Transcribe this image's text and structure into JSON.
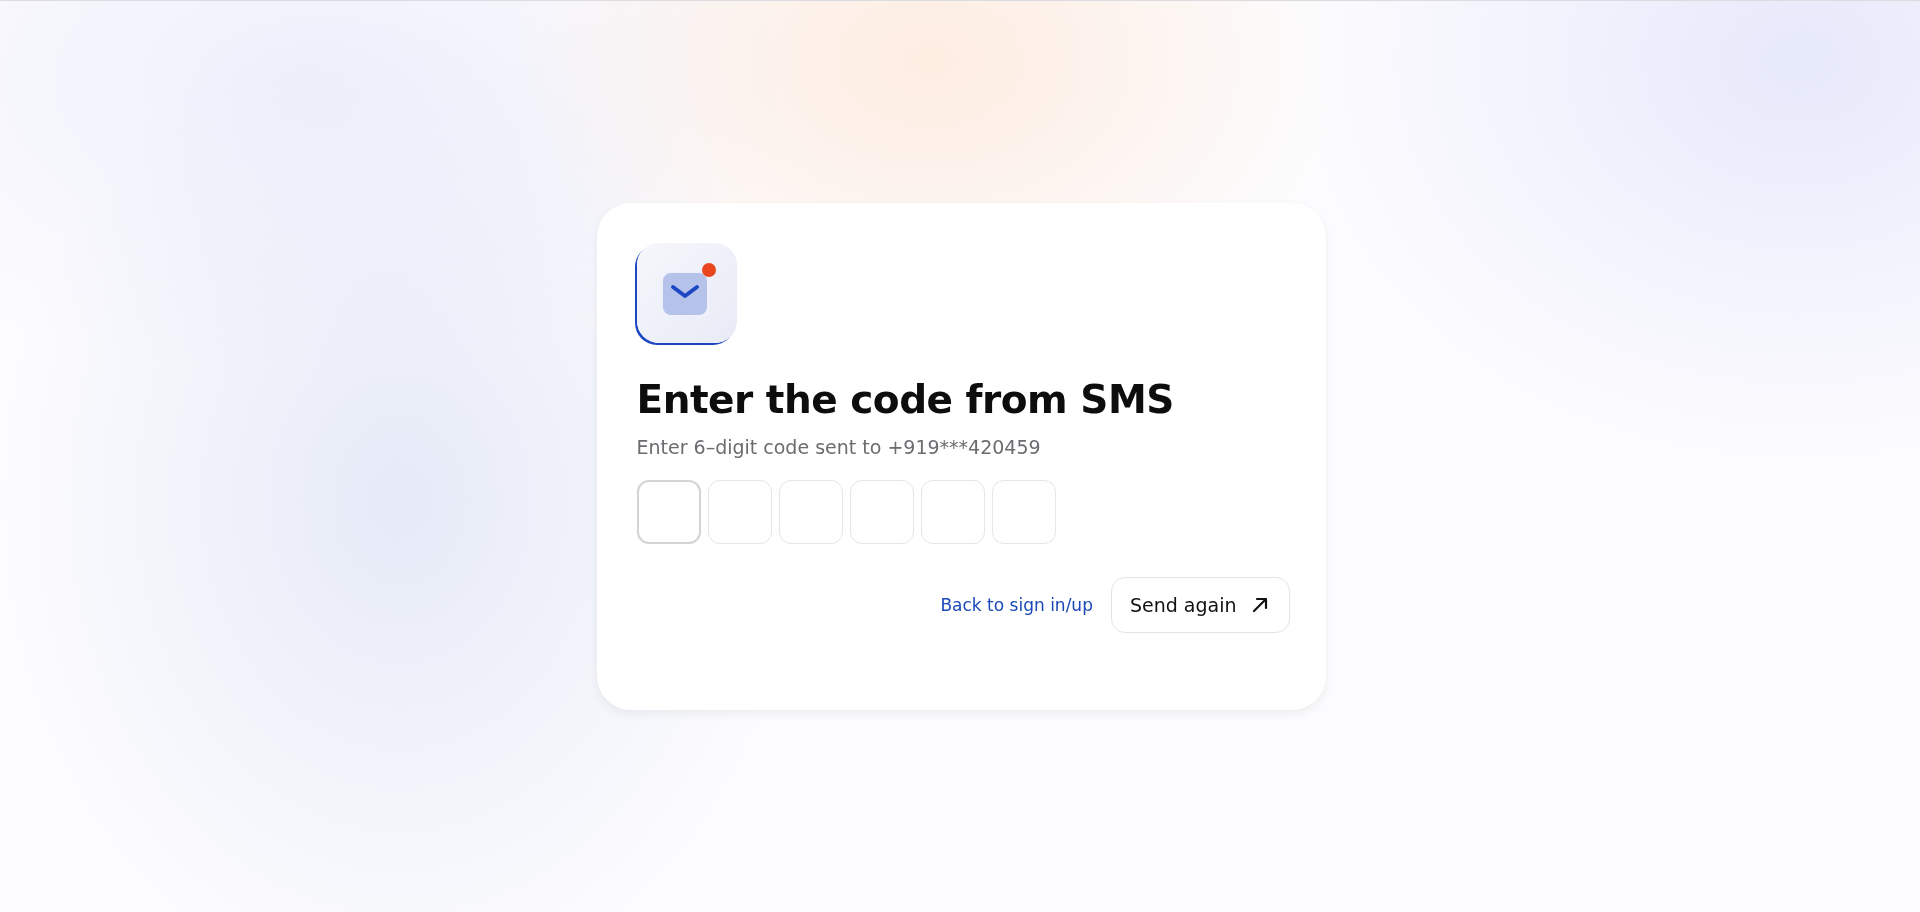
{
  "dialog": {
    "title": "Enter the code from SMS",
    "subtitle": "Enter 6–digit code sent to +919***420459",
    "code_boxes": [
      {
        "selected": true
      },
      {
        "selected": false
      },
      {
        "selected": false
      },
      {
        "selected": false
      },
      {
        "selected": false
      },
      {
        "selected": false
      }
    ],
    "back_link": "Back to sign in/up",
    "send_button": "Send again"
  }
}
